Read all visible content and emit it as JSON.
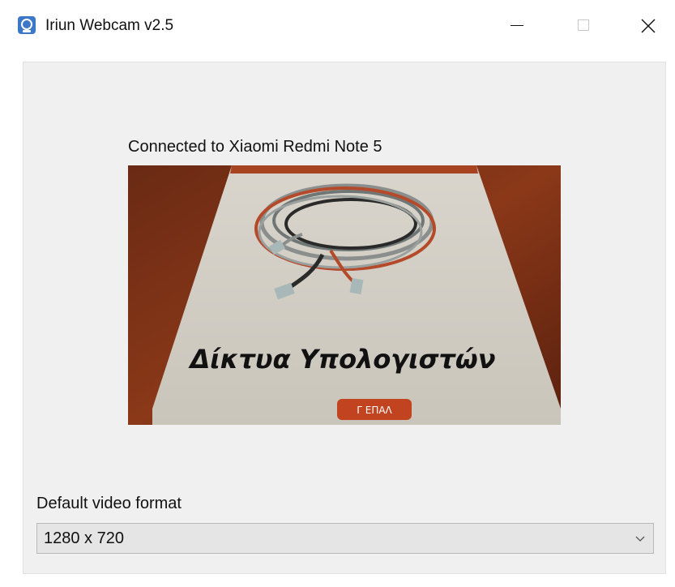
{
  "window": {
    "title": "Iriun Webcam v2.5",
    "controls": {
      "minimize": "minimize-icon",
      "maximize": "maximize-icon",
      "close": "close-icon"
    }
  },
  "main": {
    "connection_status": "Connected to Xiaomi Redmi Note 5",
    "preview": {
      "book_title": "Δίκτυα Υπολογιστών",
      "book_badge": "Γ ΕΠΑΛ"
    },
    "format": {
      "label": "Default video format",
      "selected": "1280 x 720"
    }
  },
  "colors": {
    "panel_bg": "#f0f0f0",
    "select_bg": "#e5e5e5",
    "app_icon": "#3d78c8",
    "badge": "#c1431f"
  }
}
